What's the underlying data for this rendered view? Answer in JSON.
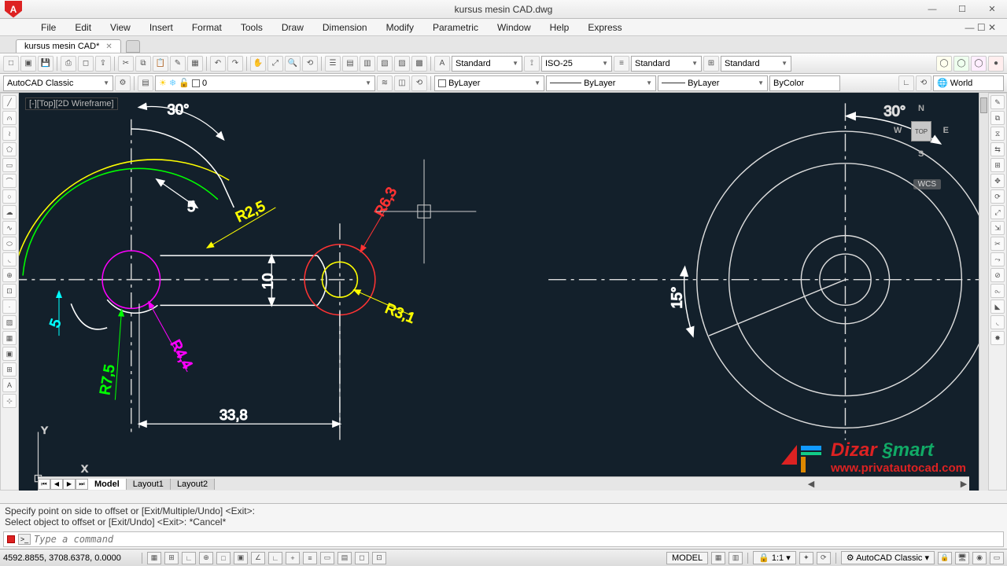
{
  "title": "kursus mesin CAD.dwg",
  "app_initial": "A",
  "menus": [
    "File",
    "Edit",
    "View",
    "Insert",
    "Format",
    "Tools",
    "Draw",
    "Dimension",
    "Modify",
    "Parametric",
    "Window",
    "Help",
    "Express"
  ],
  "filetab": {
    "name": "kursus mesin CAD*"
  },
  "styles": {
    "text": "Standard",
    "dim": "ISO-25",
    "ml": "Standard",
    "tbl": "Standard"
  },
  "workspace": "AutoCAD Classic",
  "layer_zero": "0",
  "props": {
    "layer": "ByLayer",
    "ltype": "ByLayer",
    "lweight": "ByLayer",
    "color": "ByColor"
  },
  "ucs": "World",
  "viewport": "[-][Top][2D Wireframe]",
  "viewcube": {
    "face": "TOP",
    "n": "N",
    "s": "S",
    "e": "E",
    "w": "W"
  },
  "wcs_label": "WCS",
  "dimensions": {
    "ang30_left": "30°",
    "ang30_right": "30°",
    "d5": "5",
    "r25": "R2,5",
    "r63": "R6,3",
    "d10": "10",
    "r31": "R3,1",
    "d5v": "5",
    "r75": "R7,5",
    "r44": "R4,4",
    "d338": "33,8",
    "a15": "15°"
  },
  "tabs": {
    "model": "Model",
    "l1": "Layout1",
    "l2": "Layout2"
  },
  "cmd": {
    "line1": "Specify point on side to offset or [Exit/Multiple/Undo] <Exit>:",
    "line2": "Select object to offset or [Exit/Undo] <Exit>: *Cancel*",
    "placeholder": "Type a command"
  },
  "status": {
    "coords": "4592.8855, 3708.6378, 0.0000",
    "model": "MODEL",
    "scale": "1:1",
    "ws": "AutoCAD Classic"
  },
  "watermark": {
    "brand_d": "Dizar ",
    "brand_s": "§mart",
    "url": "www.privatautocad.com"
  }
}
